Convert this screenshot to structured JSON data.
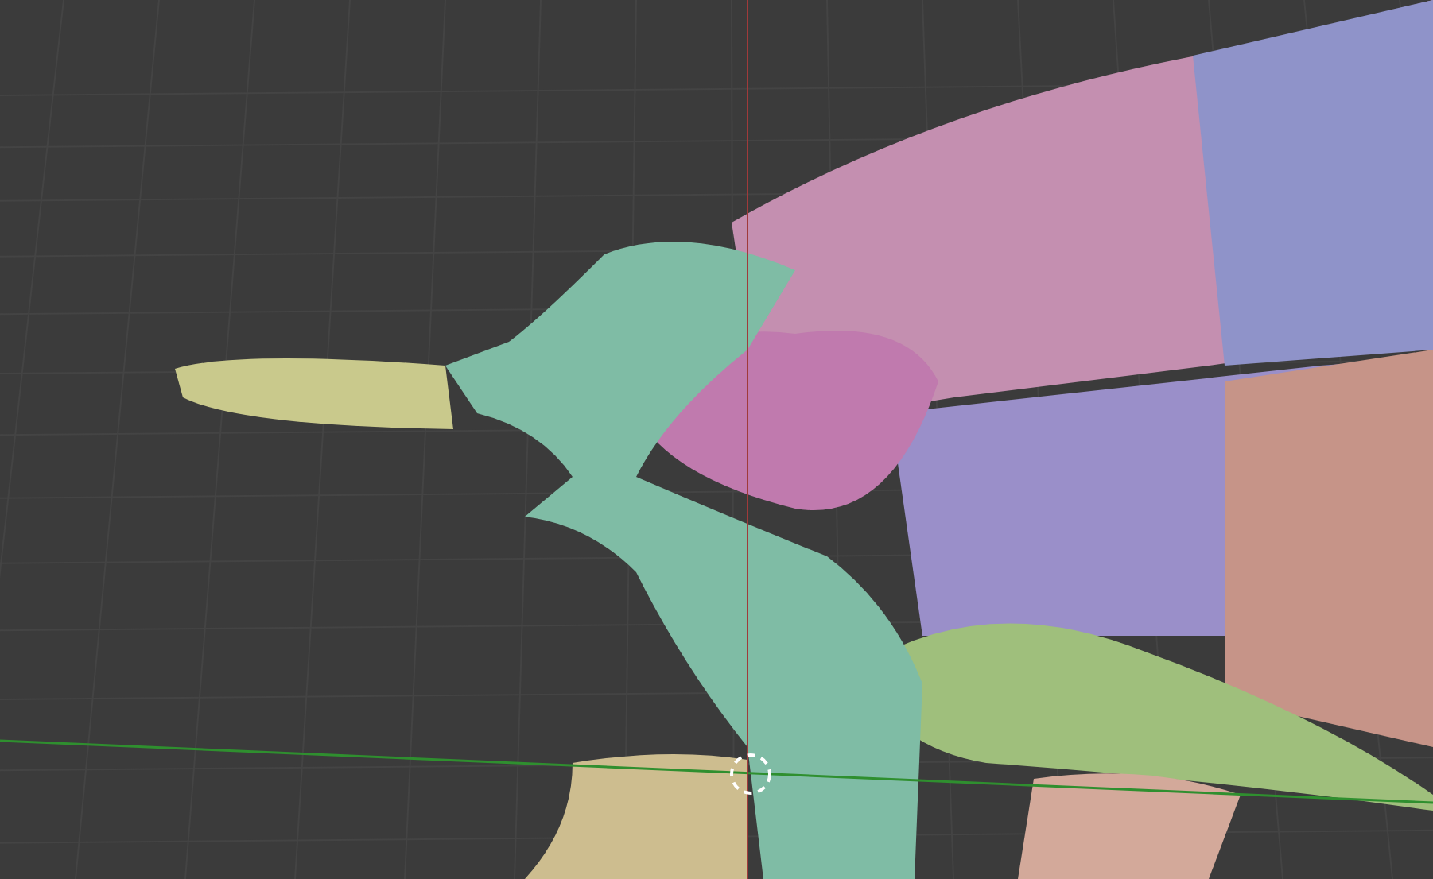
{
  "viewport": {
    "grid": true,
    "cursor_3d": true
  }
}
